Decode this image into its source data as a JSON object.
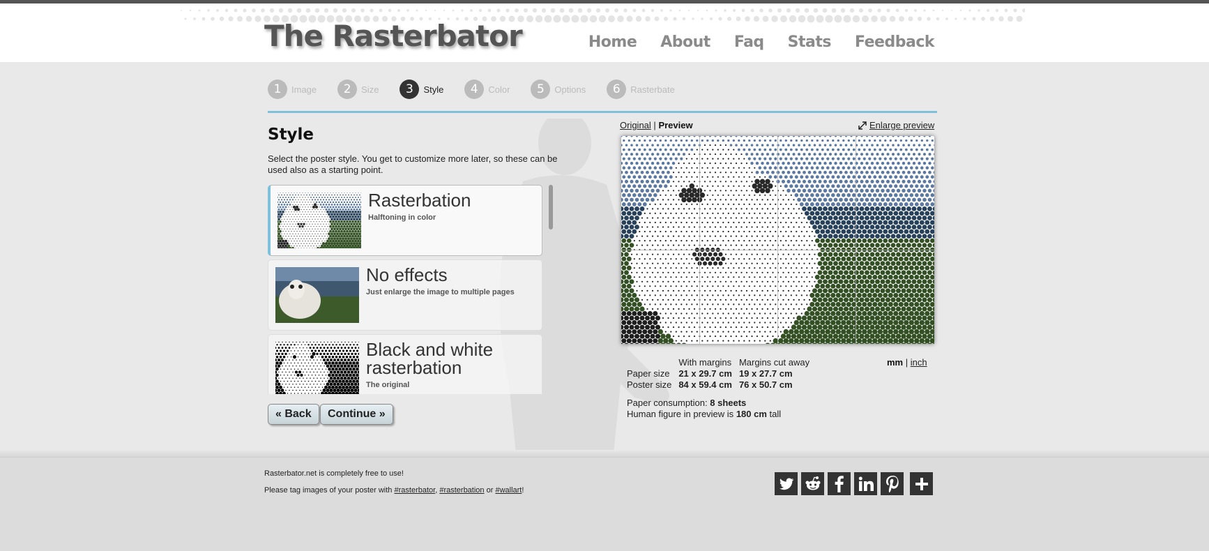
{
  "header": {
    "logo": "The Rasterbator",
    "nav": [
      "Home",
      "About",
      "Faq",
      "Stats",
      "Feedback"
    ]
  },
  "steps": [
    {
      "num": "1",
      "label": "Image"
    },
    {
      "num": "2",
      "label": "Size"
    },
    {
      "num": "3",
      "label": "Style"
    },
    {
      "num": "4",
      "label": "Color"
    },
    {
      "num": "5",
      "label": "Options"
    },
    {
      "num": "6",
      "label": "Rasterbate"
    }
  ],
  "active_step": 3,
  "style_section": {
    "title": "Style",
    "description": "Select the poster style. You get to customize more later, so these can be used also as a starting point.",
    "options": [
      {
        "title": "Rasterbation",
        "subtitle": "Halftoning in color"
      },
      {
        "title": "No effects",
        "subtitle": "Just enlarge the image to multiple pages"
      },
      {
        "title": "Black and white rasterbation",
        "subtitle": "The original"
      }
    ]
  },
  "buttons": {
    "back": "« Back",
    "continue": "Continue »"
  },
  "preview": {
    "original_link": "Original",
    "separator": "|",
    "preview_label": "Preview",
    "enlarge_link": "Enlarge preview"
  },
  "sizes": {
    "col_margins": "With margins",
    "col_cut": "Margins cut away",
    "paper_label": "Paper size",
    "paper_margins": "21 x 29.7 cm",
    "paper_cut": "19 x 27.7 cm",
    "poster_label": "Poster size",
    "poster_margins": "84 x 59.4 cm",
    "poster_cut": "76 x 50.7 cm",
    "unit_mm": "mm",
    "unit_sep": "|",
    "unit_inch": "inch"
  },
  "consumption": {
    "paper_label": "Paper consumption:",
    "paper_value": "8 sheets",
    "human_label": "Human figure in preview is",
    "human_value": "180 cm",
    "human_suffix": "tall"
  },
  "footer": {
    "line1": "Rasterbator.net is completely free to use!",
    "line2_prefix": "Please tag images of your poster with",
    "tag1": "#rasterbator",
    "comma": ",",
    "tag2": "#rasterbation",
    "or": "or",
    "tag3": "#wallart",
    "excl": "!"
  },
  "social_icons": [
    "twitter-icon",
    "reddit-icon",
    "facebook-icon",
    "linkedin-icon",
    "pinterest-icon",
    "plus-icon"
  ],
  "colors": {
    "accent": "#7fc0dc",
    "dark": "#333333"
  }
}
